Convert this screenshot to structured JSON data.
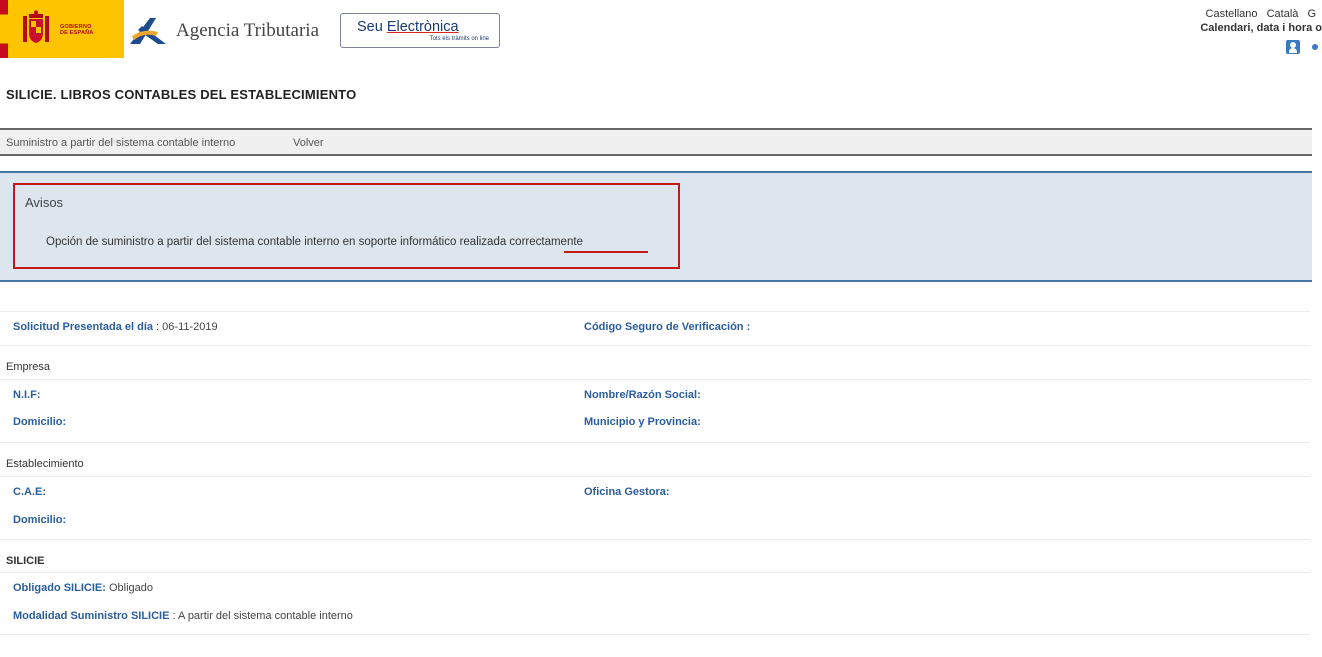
{
  "header": {
    "gov_line1": "GOBIERNO",
    "gov_line2": "DE ESPAÑA",
    "agency_name": "Agencia Tributaria",
    "seu_title_a": "Seu ",
    "seu_title_b": "Electrònica",
    "seu_sub": "Tots els tràmits on line",
    "languages": [
      "Castellano",
      "Català",
      "G"
    ],
    "calendar_link": "Calendari, data i hora o"
  },
  "page_title": "SILICIE. LIBROS CONTABLES DEL ESTABLECIMIENTO",
  "menu": {
    "items": [
      "Suministro a partir del sistema contable interno",
      "Volver"
    ]
  },
  "avisos": {
    "title": "Avisos",
    "message": "Opción de suministro a partir del sistema contable interno en soporte informático realizada correctamente"
  },
  "solicitud": {
    "presentada_label": "Solicitud Presentada el día",
    "presentada_sep": " : ",
    "presentada_value": "06-11-2019",
    "csv_label": "Código Seguro de Verificación :"
  },
  "empresa": {
    "heading": "Empresa",
    "nif_label": "N.I.F:",
    "nombre_label": "Nombre/Razón Social:",
    "domicilio_label": "Domicilio:",
    "municipio_label": "Municipio y Provincia:"
  },
  "establecimiento": {
    "heading": "Establecimiento",
    "cae_label": "C.A.E:",
    "oficina_label": "Oficina Gestora:",
    "domicilio_label": "Domicilio:"
  },
  "silicie": {
    "heading": "SILICIE",
    "obligado_label": "Obligado SILICIE:",
    "obligado_value": " Obligado",
    "modalidad_label": "Modalidad Suministro SILICIE",
    "modalidad_value": " : A partir del sistema contable interno"
  }
}
